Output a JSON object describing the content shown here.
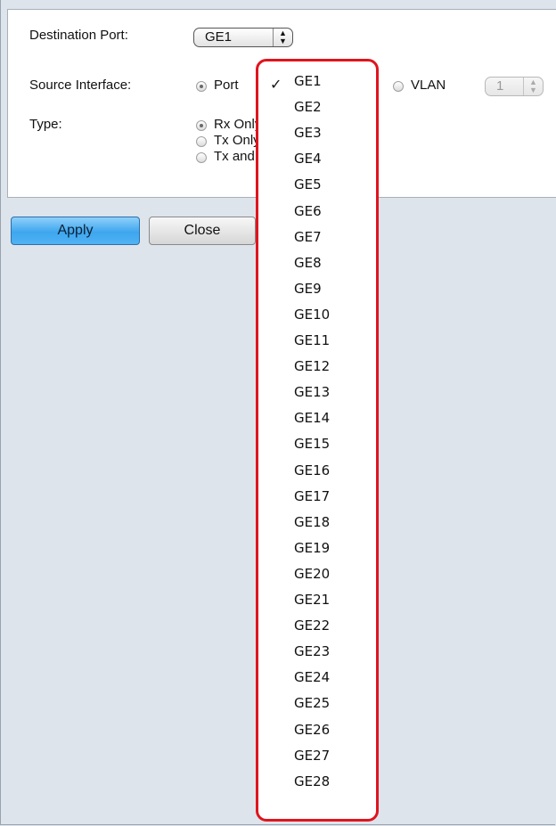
{
  "form": {
    "destination_port_label": "Destination Port:",
    "destination_port_value": "GE1",
    "source_interface_label": "Source Interface:",
    "source_port_label": "Port",
    "source_port_value": "GE1",
    "vlan_label": "VLAN",
    "vlan_value": "1",
    "type_label": "Type:",
    "type_options": [
      "Rx Only",
      "Tx Only",
      "Tx and Rx"
    ],
    "type_selected": "Rx Only"
  },
  "buttons": {
    "apply_label": "Apply",
    "close_label": "Close"
  },
  "dropdown": {
    "selected": "GE1",
    "check_glyph": "✓",
    "options": [
      "GE1",
      "GE2",
      "GE3",
      "GE4",
      "GE5",
      "GE6",
      "GE7",
      "GE8",
      "GE9",
      "GE10",
      "GE11",
      "GE12",
      "GE13",
      "GE14",
      "GE15",
      "GE16",
      "GE17",
      "GE18",
      "GE19",
      "GE20",
      "GE21",
      "GE22",
      "GE23",
      "GE24",
      "GE25",
      "GE26",
      "GE27",
      "GE28"
    ]
  },
  "colors": {
    "highlight_border": "#e0141d",
    "apply_button": "#3ea6ee",
    "page_background": "#dde4ec"
  }
}
